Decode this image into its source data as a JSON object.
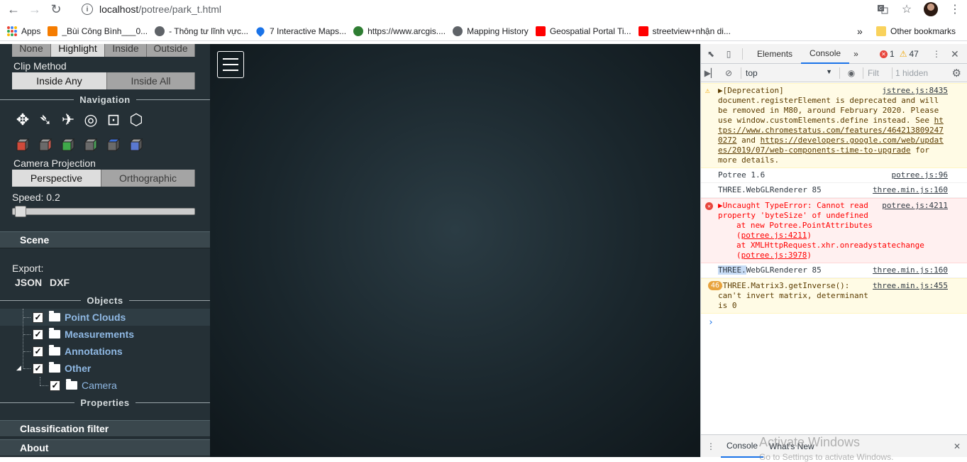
{
  "browser": {
    "url_host": "localhost",
    "url_path": "/potree/park_t.html",
    "bookmarks": [
      {
        "label": "Apps",
        "icon": "apps-grid-icon"
      },
      {
        "label": "_Bùi Công Bình___0...",
        "icon": "blogger-icon",
        "color": "#f57c00"
      },
      {
        "label": "- Thông tư lĩnh vực...",
        "icon": "globe-icon",
        "color": "#5f6368"
      },
      {
        "label": "7 Interactive Maps...",
        "icon": "map-pin-icon",
        "color": "#1a73e8"
      },
      {
        "label": "https://www.arcgis....",
        "icon": "arcgis-globe-icon",
        "color": "#2e7d32"
      },
      {
        "label": "Mapping History",
        "icon": "globe-icon",
        "color": "#5f6368"
      },
      {
        "label": "Geospatial Portal Ti...",
        "icon": "youtube-icon",
        "color": "#ff0000"
      },
      {
        "label": "streetview+nhận di...",
        "icon": "youtube-icon",
        "color": "#ff0000"
      }
    ],
    "more_bookmarks": "»",
    "other_bookmarks": "Other bookmarks"
  },
  "sidebar": {
    "clip_mode_options": [
      "None",
      "Highlight",
      "Inside",
      "Outside"
    ],
    "clip_mode_selected": "Highlight",
    "clip_method_label": "Clip Method",
    "clip_method_options": [
      "Inside Any",
      "Inside All"
    ],
    "clip_method_selected": "Inside Any",
    "navigation_title": "Navigation",
    "nav_controls": [
      "earth-control-icon",
      "fly-control-icon",
      "helicopter-control-icon",
      "orbit-control-icon",
      "zoom-extent-icon",
      "navigation-cube-icon"
    ],
    "view_cubes": [
      {
        "name": "left-view-icon",
        "color": "#d04a3a"
      },
      {
        "name": "right-view-icon",
        "color": "#c75a50"
      },
      {
        "name": "front-view-icon",
        "color": "#3fa84a"
      },
      {
        "name": "back-view-icon",
        "color": "#4aa059"
      },
      {
        "name": "top-view-icon",
        "color": "#3c6fd8"
      },
      {
        "name": "bottom-view-icon",
        "color": "#5a78d0"
      }
    ],
    "camera_projection_label": "Camera Projection",
    "projection_options": [
      "Perspective",
      "Orthographic"
    ],
    "projection_selected": "Perspective",
    "speed_label": "Speed: 0.2",
    "speed_value": 0.2,
    "scene_title": "Scene",
    "export_label": "Export:",
    "export_json": "JSON",
    "export_dxf": "DXF",
    "objects_title": "Objects",
    "tree": [
      {
        "label": "Point Clouds",
        "checked": true
      },
      {
        "label": "Measurements",
        "checked": true
      },
      {
        "label": "Annotations",
        "checked": true
      },
      {
        "label": "Other",
        "checked": true
      },
      {
        "label": "Camera",
        "checked": true
      }
    ],
    "properties_title": "Properties",
    "classification_title": "Classification filter",
    "about_title": "About"
  },
  "devtools": {
    "tabs": [
      "Elements",
      "Console"
    ],
    "active_tab": "Console",
    "more_tabs": "»",
    "error_count": "1",
    "warning_count": "47",
    "context": "top",
    "filter_placeholder": "Filt",
    "hidden_count": "1 hidden",
    "messages": [
      {
        "level": "warning",
        "text_1": "▶[Deprecation]",
        "text_2": "document.registerElement is deprecated and will be removed in M80, around February 2020. Please use window.customElements.define instead. See ",
        "link_1": "https://www.chromestatus.com/features/4642138092470272",
        "text_3": " and ",
        "link_2": "https://developers.google.com/web/updates/2019/07/web-components-time-to-upgrade",
        "text_4": " for more details.",
        "source": "jstree.js:8435"
      },
      {
        "level": "info",
        "text": "Potree 1.6",
        "source": "potree.js:96"
      },
      {
        "level": "info",
        "text": "THREE.WebGLRenderer 85",
        "source": "three.min.js:160"
      },
      {
        "level": "error",
        "text_1": "▶Uncaught TypeError: Cannot read property 'byteSize' of undefined",
        "text_2": "at new Potree.PointAttributes (",
        "link_1": "potree.js:4211",
        "text_3": ")",
        "text_4": "at XMLHttpRequest.xhr.onreadystatechange (",
        "link_2": "potree.js:3978",
        "text_5": ")",
        "source": "potree.js:4211"
      },
      {
        "level": "info",
        "text_sel": "THREE.",
        "text": "WebGLRenderer 85",
        "source": "three.min.js:160"
      },
      {
        "level": "warning",
        "count": "46",
        "text": "▶THREE.Matrix3.getInverse(): can't invert matrix, determinant is 0",
        "source": "three.min.js:455"
      }
    ],
    "prompt": "›",
    "drawer_tabs": [
      "Console",
      "What's New"
    ],
    "watermark_1": "Activate Windows",
    "watermark_2": "Go to Settings to activate Windows."
  }
}
